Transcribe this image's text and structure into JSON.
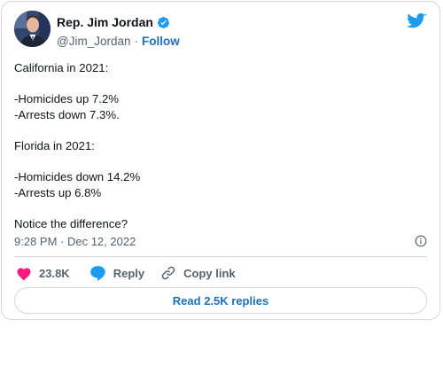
{
  "author": {
    "display_name": "Rep. Jim Jordan",
    "handle": "@Jim_Jordan",
    "separator": "·",
    "follow_label": "Follow",
    "verified_icon": "verified-badge-icon"
  },
  "tweet": {
    "lines": [
      "California in 2021:",
      "",
      "-Homicides up 7.2%",
      "-Arrests down 7.3%.",
      "",
      "Florida in 2021:",
      "",
      "-Homicides down 14.2%",
      "-Arrests up 6.8%",
      "",
      "Notice the difference?"
    ],
    "timestamp": "9:28 PM · Dec 12, 2022"
  },
  "actions": {
    "like_count": "23.8K",
    "reply_label": "Reply",
    "copy_link_label": "Copy link"
  },
  "read_replies_label": "Read 2.5K replies",
  "colors": {
    "like": "#f91880",
    "reply": "#1d9bf0",
    "link": "#1d6fb8",
    "twitter_blue": "#1d9bf0",
    "muted": "#536471",
    "border": "#cfd9de"
  }
}
